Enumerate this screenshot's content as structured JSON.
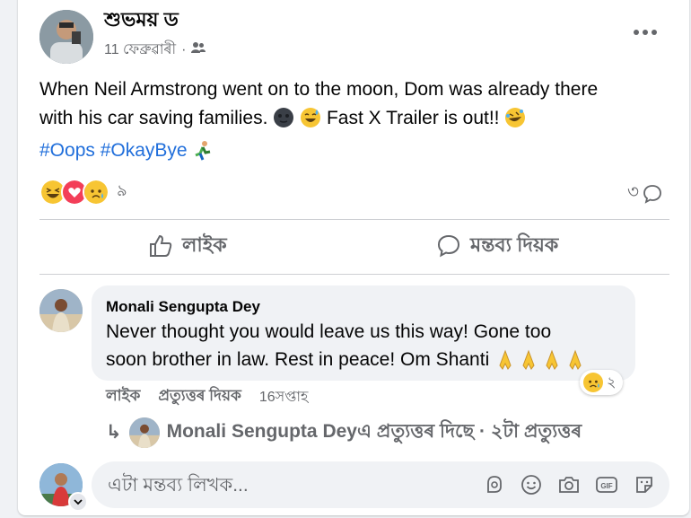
{
  "post": {
    "author_name": "শুভময় ড",
    "date": "11 ফেব্রুৱাৰী",
    "meta_sep": "·",
    "audience_icon": "friends-icon",
    "more_icon": "more-horizontal-icon",
    "text_line1": "When Neil Armstrong went on to the moon, Dom was already there",
    "text_line2": "with his car saving families.",
    "text_trailer": "Fast X Trailer is out!!",
    "hashtag1": "#Oops",
    "hashtag2": "#OkayBye",
    "reaction_count": "৯",
    "comment_count": "৩"
  },
  "actions": {
    "like_label": "লাইক",
    "comment_label": "মন্তব্য দিয়ক"
  },
  "comment": {
    "author": "Monali Sengupta Dey",
    "text_line1": "Never thought you would leave us this way! Gone too",
    "text_line2": "soon brother in law. Rest in peace! Om Shanti",
    "reaction_count": "২",
    "like_label": "লাইক",
    "reply_label": "প্ৰত্যুত্তৰ দিয়ক",
    "time": "16সপ্তাহ"
  },
  "replies": {
    "arrow": "↳",
    "text": "Monali Sengupta Deyএ প্ৰত্যুত্তৰ দিছে · ২টা প্ৰত্যুত্তৰ"
  },
  "compose": {
    "placeholder": "এটা মন্তব্য লিখক..."
  },
  "colors": {
    "link": "#216fdb",
    "secondary_text": "#65676b",
    "bubble_bg": "#f0f2f5"
  }
}
